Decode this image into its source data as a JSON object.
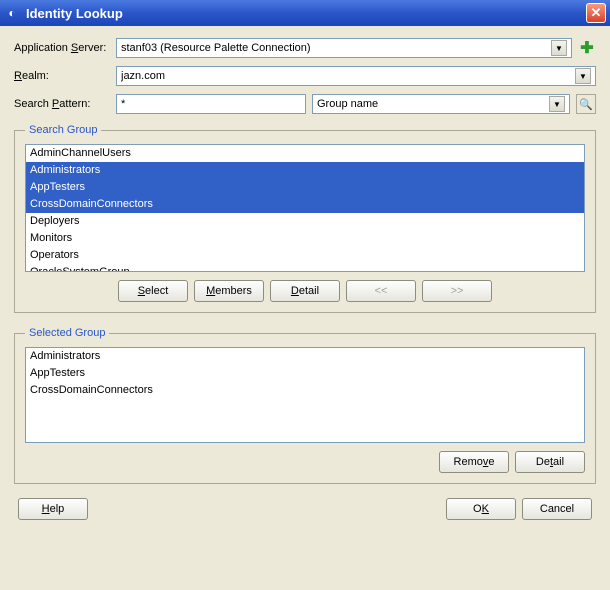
{
  "titlebar": {
    "title": "Identity Lookup"
  },
  "form": {
    "appserver_label_pre": "Application ",
    "appserver_label_u": "S",
    "appserver_label_post": "erver:",
    "appserver_value": "stanf03 (Resource Palette Connection)",
    "realm_label_u": "R",
    "realm_label_post": "ealm:",
    "realm_value": "jazn.com",
    "pattern_label_pre": "Search ",
    "pattern_label_u": "P",
    "pattern_label_post": "attern:",
    "pattern_value": "*",
    "search_type_value": "Group name"
  },
  "search_group_legend": "Search Group",
  "search_items": [
    {
      "label": "AdminChannelUsers",
      "selected": false
    },
    {
      "label": "Administrators",
      "selected": true
    },
    {
      "label": "AppTesters",
      "selected": true
    },
    {
      "label": "CrossDomainConnectors",
      "selected": true
    },
    {
      "label": "Deployers",
      "selected": false
    },
    {
      "label": "Monitors",
      "selected": false
    },
    {
      "label": "Operators",
      "selected": false
    },
    {
      "label": "OracleSystemGroup",
      "selected": false
    }
  ],
  "search_buttons": {
    "select_u": "S",
    "select_post": "elect",
    "members_u": "M",
    "members_post": "embers",
    "detail_u": "D",
    "detail_post": "etail",
    "prev": "<<",
    "next": ">>"
  },
  "selected_group_legend": "Selected Group",
  "selected_items": [
    {
      "label": "Administrators"
    },
    {
      "label": "AppTesters"
    },
    {
      "label": "CrossDomainConnectors"
    }
  ],
  "selected_buttons": {
    "remove_pre": "Remo",
    "remove_u": "v",
    "remove_post": "e",
    "detail_pre": "De",
    "detail_u": "t",
    "detail_post": "ail"
  },
  "bottom": {
    "help_u": "H",
    "help_post": "elp",
    "ok_pre": "O",
    "ok_u": "K",
    "cancel": "Cancel"
  }
}
